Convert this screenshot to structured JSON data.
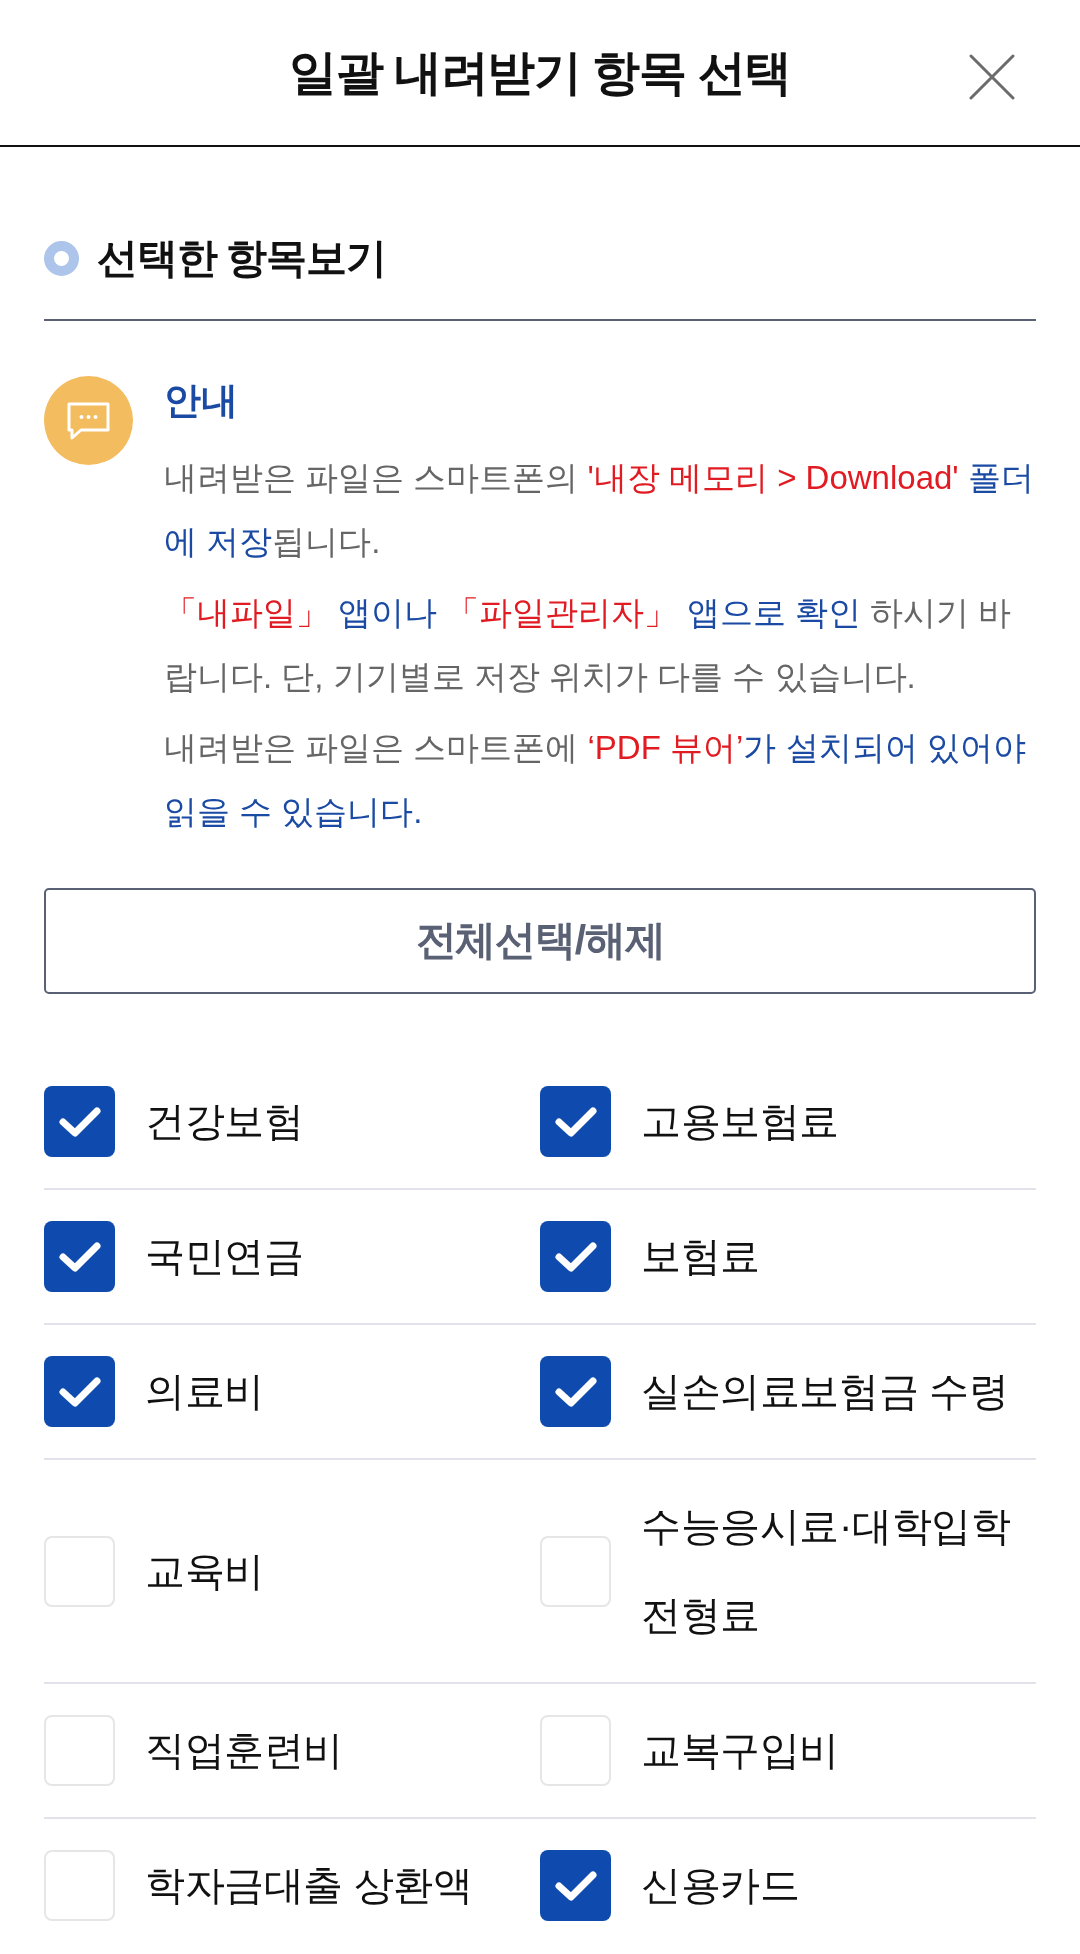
{
  "header": {
    "title": "일괄 내려받기 항목 선택"
  },
  "section": {
    "title": "선택한 항목보기"
  },
  "notice": {
    "title": "안내",
    "paragraphs": [
      [
        {
          "text": "내려받은 파일은 스마트폰의 ",
          "kind": "normal"
        },
        {
          "text": "'내장 메모리 > Download'",
          "kind": "alert"
        },
        {
          "text": " 폴더에 저장",
          "kind": "emphasis"
        },
        {
          "text": "됩니다.",
          "kind": "normal"
        }
      ],
      [
        {
          "text": "「내파일」",
          "kind": "alert"
        },
        {
          "text": " 앱이나 ",
          "kind": "emphasis"
        },
        {
          "text": "「파일관리자」",
          "kind": "alert"
        },
        {
          "text": " 앱으로 확인",
          "kind": "emphasis"
        },
        {
          "text": " 하시기 바랍니다. 단, 기기별로 저장 위치가 다를 수 있습니다.",
          "kind": "normal"
        }
      ],
      [
        {
          "text": "내려받은 파일은 스마트폰에 ",
          "kind": "normal"
        },
        {
          "text": "‘PDF 뷰어’",
          "kind": "alert"
        },
        {
          "text": "가 설치되어 있어야 읽을 수 있습니다.",
          "kind": "emphasis"
        }
      ]
    ]
  },
  "select_all_button": {
    "label": "전체선택/해제"
  },
  "rows": [
    {
      "items": [
        {
          "label": "건강보험",
          "checked": true
        },
        {
          "label": "고용보험료",
          "checked": true
        }
      ]
    },
    {
      "items": [
        {
          "label": "국민연금",
          "checked": true
        },
        {
          "label": "보험료",
          "checked": true
        }
      ]
    },
    {
      "items": [
        {
          "label": "의료비",
          "checked": true
        },
        {
          "label": "실손의료보험금 수령",
          "checked": true
        }
      ]
    },
    {
      "items": [
        {
          "label": "교육비",
          "checked": false
        },
        {
          "label": "수능응시료·대학입학전형료",
          "checked": false
        }
      ]
    },
    {
      "items": [
        {
          "label": "직업훈련비",
          "checked": false
        },
        {
          "label": "교복구입비",
          "checked": false
        }
      ]
    },
    {
      "items": [
        {
          "label": "학자금대출 상환액",
          "checked": false
        },
        {
          "label": "신용카드",
          "checked": true
        }
      ]
    }
  ]
}
